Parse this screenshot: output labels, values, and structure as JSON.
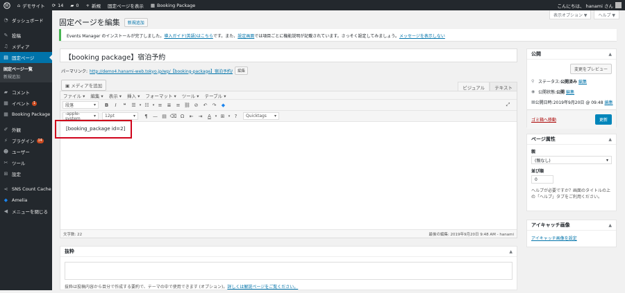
{
  "adminbar": {
    "wp_icon": "wordpress-logo",
    "site_name": "デモサイト",
    "updates_count": "14",
    "comments_count": "0",
    "new_label": "新規",
    "view_page_label": "固定ページを表示",
    "booking_label": "Booking Package",
    "greeting": "こんにちは、 hanami さん"
  },
  "sidebar": {
    "items": [
      {
        "label": "ダッシュボード",
        "icon": "dashboard-icon"
      },
      {
        "label": "投稿",
        "icon": "pin-icon"
      },
      {
        "label": "メディア",
        "icon": "media-icon"
      },
      {
        "label": "固定ページ",
        "icon": "pages-icon"
      },
      {
        "label": "コメント",
        "icon": "comment-icon"
      },
      {
        "label": "イベント",
        "icon": "calendar-icon",
        "badge": "1"
      },
      {
        "label": "Booking Package",
        "icon": "calendar-icon"
      },
      {
        "label": "外観",
        "icon": "brush-icon"
      },
      {
        "label": "プラグイン",
        "icon": "plugin-icon",
        "badge": "14"
      },
      {
        "label": "ユーザー",
        "icon": "user-icon"
      },
      {
        "label": "ツール",
        "icon": "wrench-icon"
      },
      {
        "label": "設定",
        "icon": "settings-icon"
      },
      {
        "label": "SNS Count Cache",
        "icon": "share-icon"
      },
      {
        "label": "Amelia",
        "icon": "amelia-icon"
      },
      {
        "label": "メニューを閉じる",
        "icon": "collapse-icon"
      }
    ],
    "sub_items": [
      {
        "label": "固定ページ一覧"
      },
      {
        "label": "新規追加"
      }
    ]
  },
  "screen_options_label": "表示オプション ▼",
  "help_label": "ヘルプ ▼",
  "page_title": "固定ページを編集",
  "add_new_label": "新規追加",
  "notice": {
    "text1": "Events Manager のインストールが完了しました。",
    "link1": "導入ガイド(英語)はこちら",
    "text2": "です。また、",
    "link2": "設定画面",
    "text3": "では項目ごとに機能説明が記載されています。さっそく設定してみましょう。",
    "link3": "メッセージを表示しない"
  },
  "post_title": "【booking package】宿泊予約",
  "permalink": {
    "label": "パーマリンク:",
    "url": "http://demo4.hanami-web.tokyo.jp/wp/【booking-package】宿泊予約/",
    "edit": "編集"
  },
  "media_button": "メディアを追加",
  "editor": {
    "tab_visual": "ビジュアル",
    "tab_text": "テキスト",
    "menus": [
      "ファイル ▾",
      "編集 ▾",
      "表示 ▾",
      "挿入 ▾",
      "フォーマット ▾",
      "ツール ▾",
      "テーブル ▾"
    ],
    "format_select": "段落",
    "font_select": "-apple-system",
    "size_select": "12pt",
    "quicktags_select": "Quicktags",
    "content": "[booking_package id=2]",
    "word_count": "文字数: 22",
    "last_edited": "最後の編集: 2019年9月20日 9:48 AM - hanami"
  },
  "excerpt": {
    "title": "抜粋",
    "note": "抜粋は投稿内容から目分で作成する要約で、テーマの中で使用できます (オプション)。",
    "link": "詳しくは解説ページをご覧ください。"
  },
  "publish": {
    "title": "公開",
    "preview": "変更をプレビュー",
    "status_label": "ステータス:",
    "status_value": "公開済み",
    "visibility_label": "公開状態:",
    "visibility_value": "公開",
    "date_label": "公開日時:",
    "date_value": "2019年9月20日 @ 09:48",
    "edit": "編集",
    "trash": "ゴミ箱へ移動",
    "update": "更新"
  },
  "attributes": {
    "title": "ページ属性",
    "parent_label": "親",
    "parent_value": "(親なし)",
    "order_label": "並び順",
    "order_value": "0",
    "help": "ヘルプが必要ですか？画面のタイトルの上の「ヘルプ」タブをご利用ください。"
  },
  "featured": {
    "title": "アイキャッチ画像",
    "link": "アイキャッチ画像を設定"
  },
  "highlight_color": "#d0021b",
  "accent_color": "#0073aa"
}
